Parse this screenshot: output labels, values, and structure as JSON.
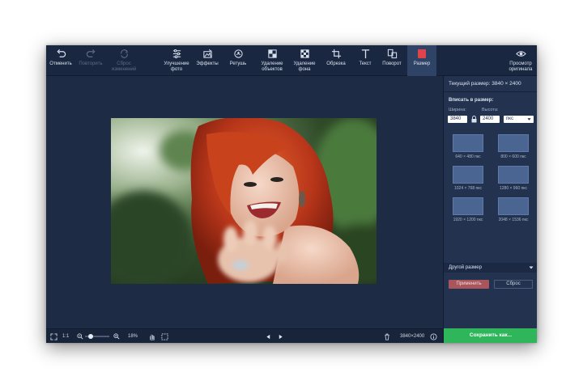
{
  "toolbar": {
    "undo": "Отменить",
    "redo": "Повторить",
    "reset_changes": "Сброс\nизменений",
    "enhance": "Улучшение\nфото",
    "effects": "Эффекты",
    "retouch": "Ретушь",
    "object_removal": "Удаление\nобъектов",
    "bg_removal": "Удаление\nфона",
    "crop": "Обрезка",
    "text": "Текст",
    "rotate": "Поворот",
    "resize": "Размер",
    "preview_original": "Просмотр\nоригинала"
  },
  "bottom": {
    "ratio": "1:1",
    "zoom": "18%",
    "zoom_level": 0.18,
    "dimensions": "3840×2400"
  },
  "panel": {
    "current_size": "Текущий размер: 3840 × 2400",
    "fit_title": "Вписать в размер:",
    "width_label": "Ширина:",
    "height_label": "Высота:",
    "width_value": "3840",
    "height_value": "2400",
    "unit": "пкс",
    "presets": [
      {
        "label": "640 × 480 пкс"
      },
      {
        "label": "800 × 600 пкс"
      },
      {
        "label": "1024 × 768 пкс"
      },
      {
        "label": "1280 × 960 пкс"
      },
      {
        "label": "1920 × 1200 пкс"
      },
      {
        "label": "2048 × 1536 пкс"
      }
    ],
    "other_size": "Другой размер",
    "apply": "Применить",
    "reset": "Сброс",
    "save": "Сохранить как..."
  },
  "colors": {
    "window_bg": "#1d2b45",
    "panel_bg": "#22324f",
    "active_tool": "#e2424b",
    "apply_button": "#a8555c",
    "save_button": "#2fb65a",
    "hair": "#c23a18"
  },
  "icons": {
    "undo": "undo-icon",
    "redo": "redo-icon",
    "reset": "reset-icon",
    "enhance": "sliders-icon",
    "effects": "effects-icon",
    "retouch": "retouch-icon",
    "object_removal": "eraser-icon",
    "bg_removal": "background-icon",
    "crop": "crop-icon",
    "text": "text-icon",
    "rotate": "rotate-icon",
    "resize": "resize-icon",
    "preview": "eye-icon"
  }
}
